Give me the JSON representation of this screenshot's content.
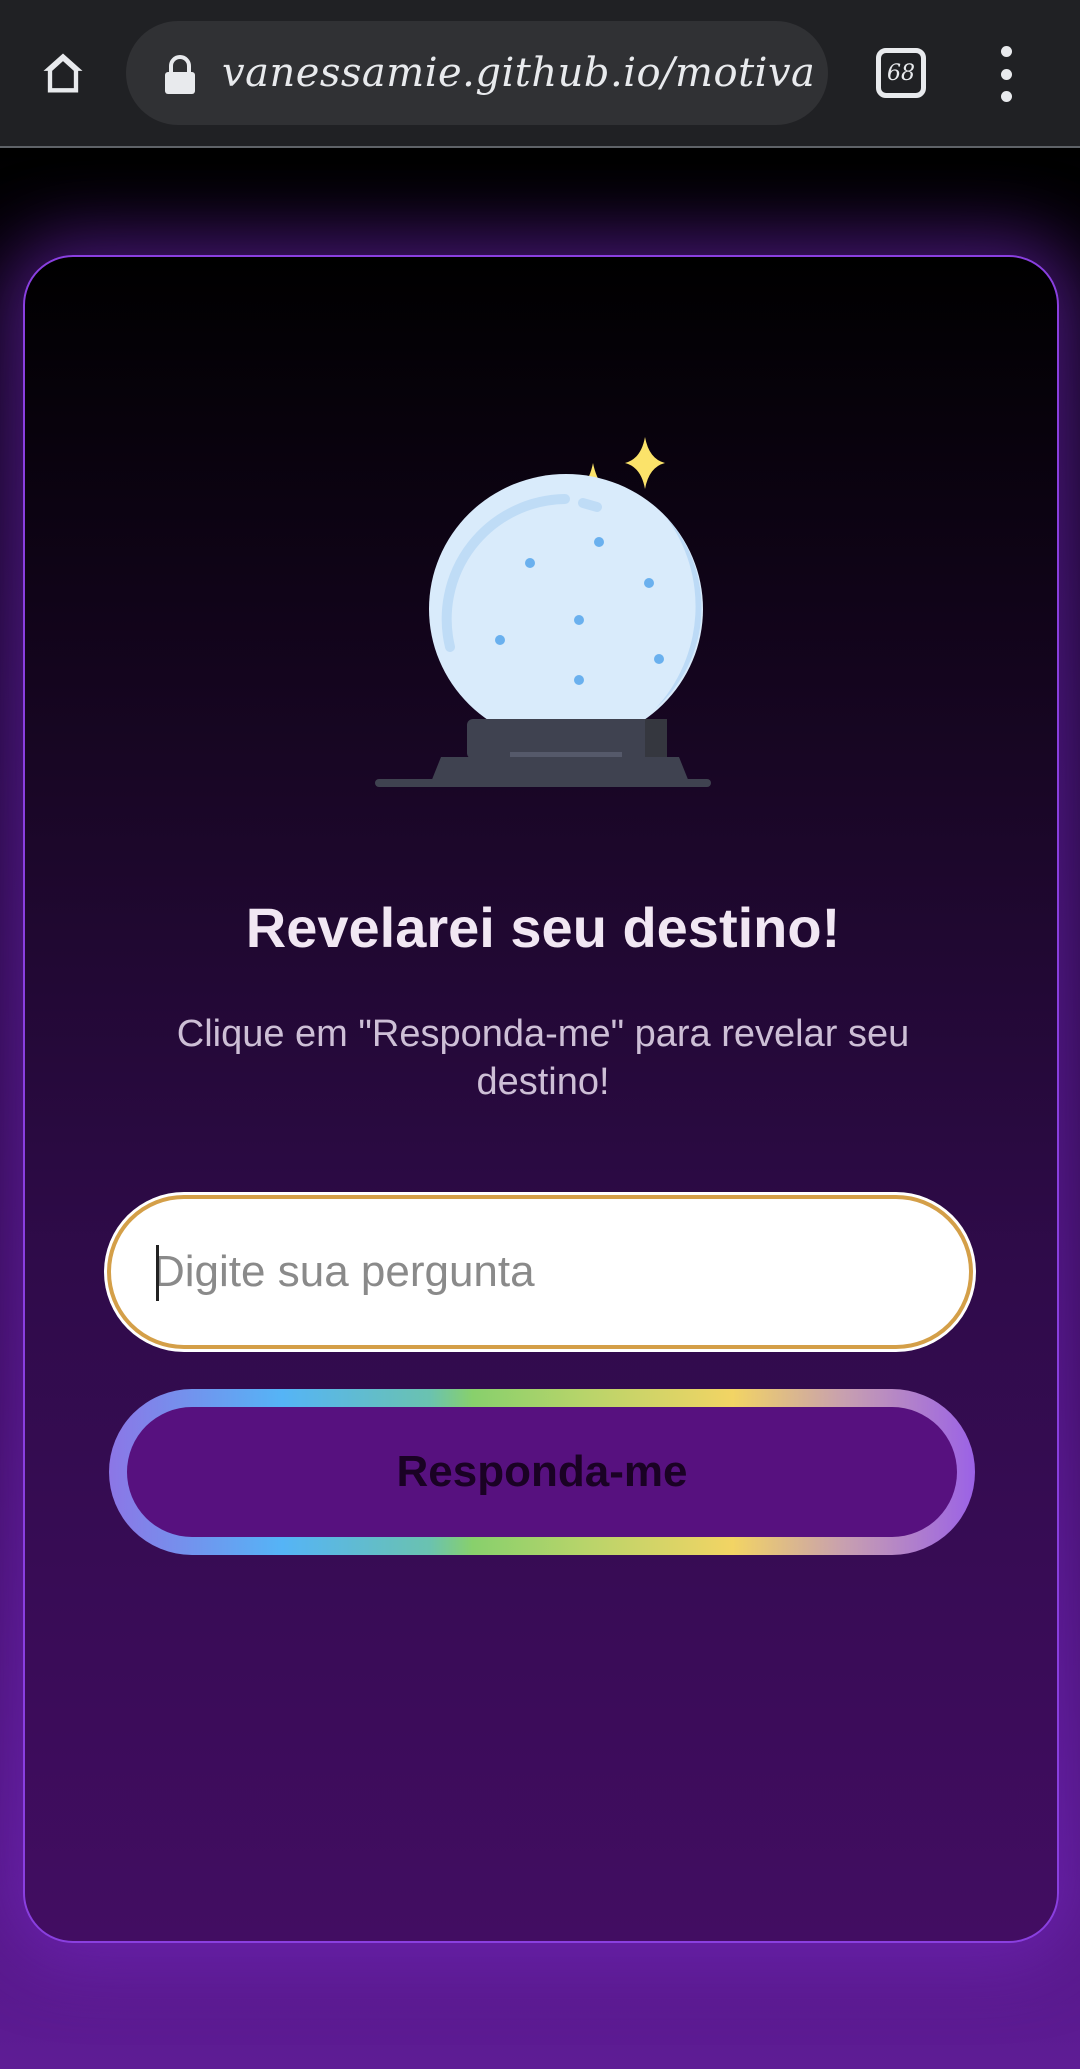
{
  "browser": {
    "url": "vanessamie.github.io/motivacio",
    "tab_count": "68"
  },
  "main": {
    "title": "Revelarei seu destino!",
    "subtitle": "Clique em \"Responda-me\" para revelar seu destino!",
    "question_placeholder": "Digite sua pergunta",
    "question_value": "",
    "answer_button_label": "Responda-me"
  },
  "icons": {
    "home": "home-icon",
    "lock": "lock-icon",
    "tabs": "tab-switcher-icon",
    "menu": "more-vert-icon",
    "orb": "crystal-ball-icon"
  },
  "colors": {
    "browser_bar": "#202124",
    "card_border": "#8a3fe0",
    "input_border": "#d49f48",
    "button_fill": "#57117f",
    "sparkle": "#fbe36a",
    "orb_glass": "#d9ebfb"
  }
}
